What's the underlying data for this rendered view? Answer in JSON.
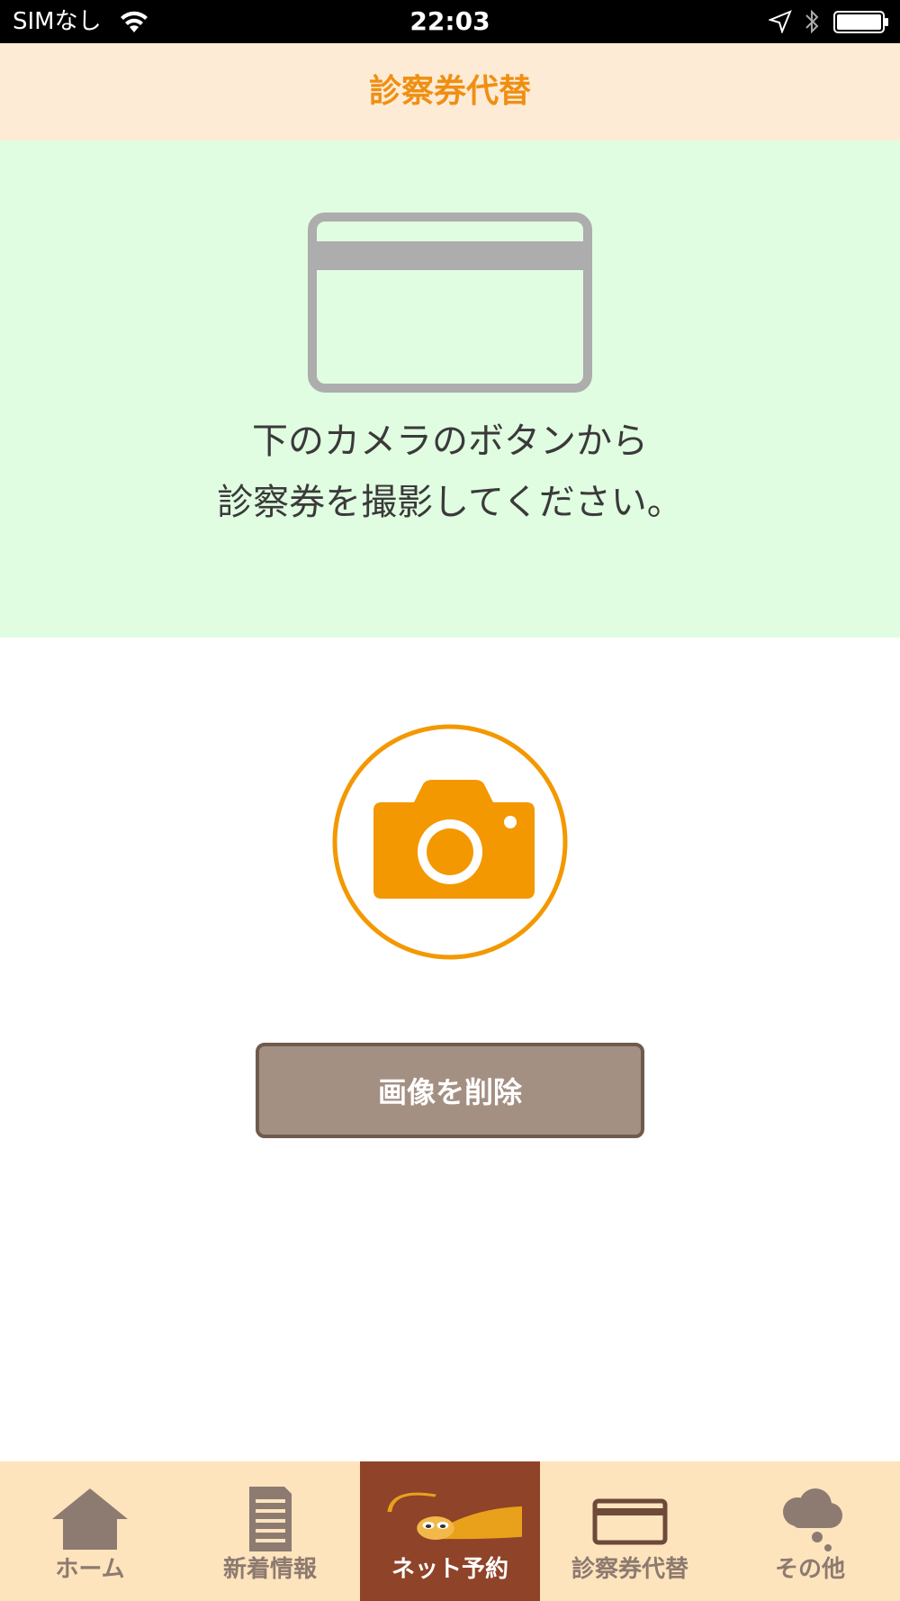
{
  "status_bar": {
    "carrier": "SIMなし",
    "time": "22:03",
    "icons": [
      "wifi-icon",
      "location-arrow-icon",
      "bluetooth-icon",
      "battery-icon"
    ]
  },
  "nav": {
    "title": "診察券代替",
    "title_color": "#ef8f12",
    "background": "#fdebd6"
  },
  "instruction": {
    "icon": "card-icon",
    "line1": "下のカメラのボタンから",
    "line2": "診察券を撮影してください。",
    "background": "#e1fde1"
  },
  "camera": {
    "icon": "camera-icon",
    "accent": "#f39800"
  },
  "delete_button": {
    "label": "画像を削除"
  },
  "tabs": [
    {
      "label": "ホーム",
      "icon": "home-icon",
      "active": false
    },
    {
      "label": "新着情報",
      "icon": "document-icon",
      "active": false
    },
    {
      "label": "ネット予約",
      "icon": "shrimp-mascot-icon",
      "active": true
    },
    {
      "label": "診察券代替",
      "icon": "card-icon",
      "active": false
    },
    {
      "label": "その他",
      "icon": "cloud-icon",
      "active": false
    }
  ],
  "colors": {
    "tabbar_bg": "#fde4bd",
    "tab_active_bg": "#8f4328",
    "tab_icon": "#8d7a70"
  }
}
